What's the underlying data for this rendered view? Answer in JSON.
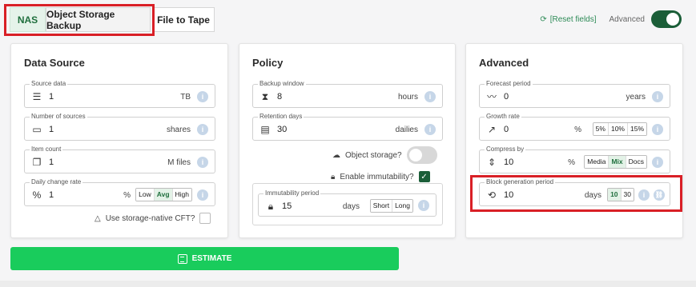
{
  "tabs": {
    "nas": "NAS",
    "object_storage": "Object Storage Backup",
    "file_to_tape": "File to Tape"
  },
  "top": {
    "reset": "[Reset fields]",
    "advanced": "Advanced",
    "advanced_on": true
  },
  "data_source": {
    "title": "Data Source",
    "source_data": {
      "label": "Source data",
      "value": "1",
      "unit": "TB"
    },
    "num_sources": {
      "label": "Number of sources",
      "value": "1",
      "unit": "shares"
    },
    "item_count": {
      "label": "Item count",
      "value": "1",
      "unit": "M files"
    },
    "daily_change": {
      "label": "Daily change rate",
      "value": "1",
      "unit": "%",
      "options": [
        "Low",
        "Avg",
        "High"
      ],
      "selected": "Avg"
    },
    "cft_label": "Use storage-native CFT?"
  },
  "policy": {
    "title": "Policy",
    "backup_window": {
      "label": "Backup window",
      "value": "8",
      "unit": "hours"
    },
    "retention_days": {
      "label": "Retention days",
      "value": "30",
      "unit": "dailies"
    },
    "object_storage_label": "Object storage?",
    "immutability_label": "Enable immutability?",
    "immutability_period": {
      "label": "Immutability period",
      "value": "15",
      "unit": "days",
      "options": [
        "Short",
        "Long"
      ]
    }
  },
  "advanced": {
    "title": "Advanced",
    "forecast": {
      "label": "Forecast period",
      "value": "0",
      "unit": "years"
    },
    "growth": {
      "label": "Growth rate",
      "value": "0",
      "unit": "%",
      "options": [
        "5%",
        "10%",
        "15%"
      ]
    },
    "compress": {
      "label": "Compress by",
      "value": "10",
      "unit": "%",
      "options": [
        "Media",
        "Mix",
        "Docs"
      ],
      "selected": "Mix"
    },
    "block_gen": {
      "label": "Block generation period",
      "value": "10",
      "unit": "days",
      "options": [
        "10",
        "30"
      ],
      "selected": "10"
    }
  },
  "estimate": "ESTIMATE"
}
